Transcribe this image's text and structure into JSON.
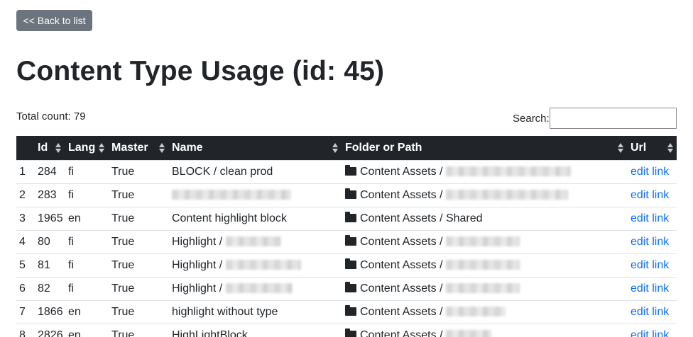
{
  "back_button": "<< Back to list",
  "page_title": "Content Type Usage (id: 45)",
  "total_count": "Total count: 79",
  "search": {
    "label": "Search:",
    "value": "",
    "placeholder": ""
  },
  "columns": [
    "",
    "Id",
    "Lang",
    "Master",
    "Name",
    "Folder or Path",
    "Url"
  ],
  "rows": [
    {
      "index": "1",
      "id": "284",
      "lang": "fi",
      "master": "True",
      "name": "BLOCK / clean prod",
      "folder": "Content Assets / ",
      "url": "edit link"
    },
    {
      "index": "2",
      "id": "283",
      "lang": "fi",
      "master": "True",
      "name": "",
      "folder": "Content Assets / ",
      "url": "edit link"
    },
    {
      "index": "3",
      "id": "1965",
      "lang": "en",
      "master": "True",
      "name": "Content highlight block",
      "folder": "Content Assets / Shared",
      "url": "edit link"
    },
    {
      "index": "4",
      "id": "80",
      "lang": "fi",
      "master": "True",
      "name": "Highlight / ",
      "folder": "Content Assets / ",
      "url": "edit link"
    },
    {
      "index": "5",
      "id": "81",
      "lang": "fi",
      "master": "True",
      "name": "Highlight / ",
      "folder": "Content Assets / ",
      "url": "edit link"
    },
    {
      "index": "6",
      "id": "82",
      "lang": "fi",
      "master": "True",
      "name": "Highlight / ",
      "folder": "Content Assets / ",
      "url": "edit link"
    },
    {
      "index": "7",
      "id": "1866",
      "lang": "en",
      "master": "True",
      "name": "highlight without type",
      "folder": "Content Assets / ",
      "url": "edit link"
    },
    {
      "index": "8",
      "id": "2826",
      "lang": "en",
      "master": "True",
      "name": "HighLightBlock",
      "folder": "Content Assets / ",
      "url": "edit link"
    }
  ],
  "icons": {
    "folder": "folder-icon",
    "sort": "sort-icon"
  },
  "colors": {
    "header_bg": "#212529",
    "button_bg": "#6c757d",
    "link": "#0d6efd"
  }
}
